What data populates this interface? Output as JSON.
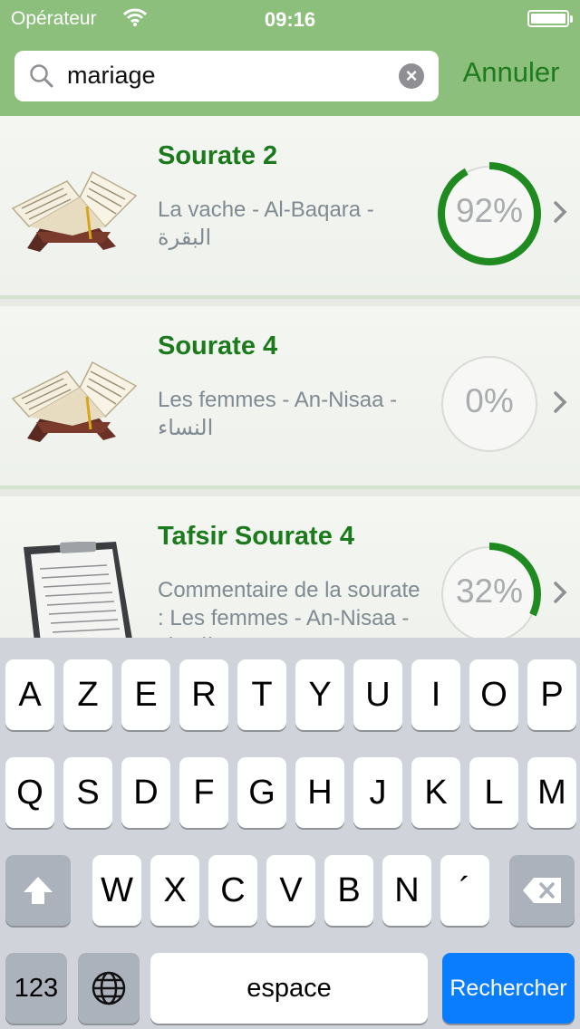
{
  "status_bar": {
    "carrier": "Opérateur",
    "time": "09:16"
  },
  "search": {
    "query": "mariage",
    "cancel_label": "Annuler"
  },
  "results": [
    {
      "title": "Sourate 2",
      "subtitle": "La vache - Al-Baqara - البقرة",
      "progress_label": "92%",
      "progress": 0.92,
      "thumb": "open-book-icon"
    },
    {
      "title": "Sourate 4",
      "subtitle": "Les femmes - An-Nisaa - النساء",
      "progress_label": "0%",
      "progress": 0.0,
      "thumb": "open-book-icon"
    },
    {
      "title": "Tafsir Sourate 4",
      "subtitle": "Commentaire de la sourate : Les femmes - An-Nisaa - النساء",
      "progress_label": "32%",
      "progress": 0.32,
      "thumb": "clipboard-document-icon"
    }
  ],
  "colors": {
    "header": "#8cbf7c",
    "title": "#1b7a1b",
    "progress_ring": "#1f8a1f",
    "return_key": "#0a7dff"
  },
  "keyboard": {
    "row1": [
      "A",
      "Z",
      "E",
      "R",
      "T",
      "Y",
      "U",
      "I",
      "O",
      "P"
    ],
    "row2": [
      "Q",
      "S",
      "D",
      "F",
      "G",
      "H",
      "J",
      "K",
      "L",
      "M"
    ],
    "row3": [
      "W",
      "X",
      "C",
      "V",
      "B",
      "N",
      "´"
    ],
    "numbers_label": "123",
    "space_label": "espace",
    "return_label": "Rechercher"
  }
}
